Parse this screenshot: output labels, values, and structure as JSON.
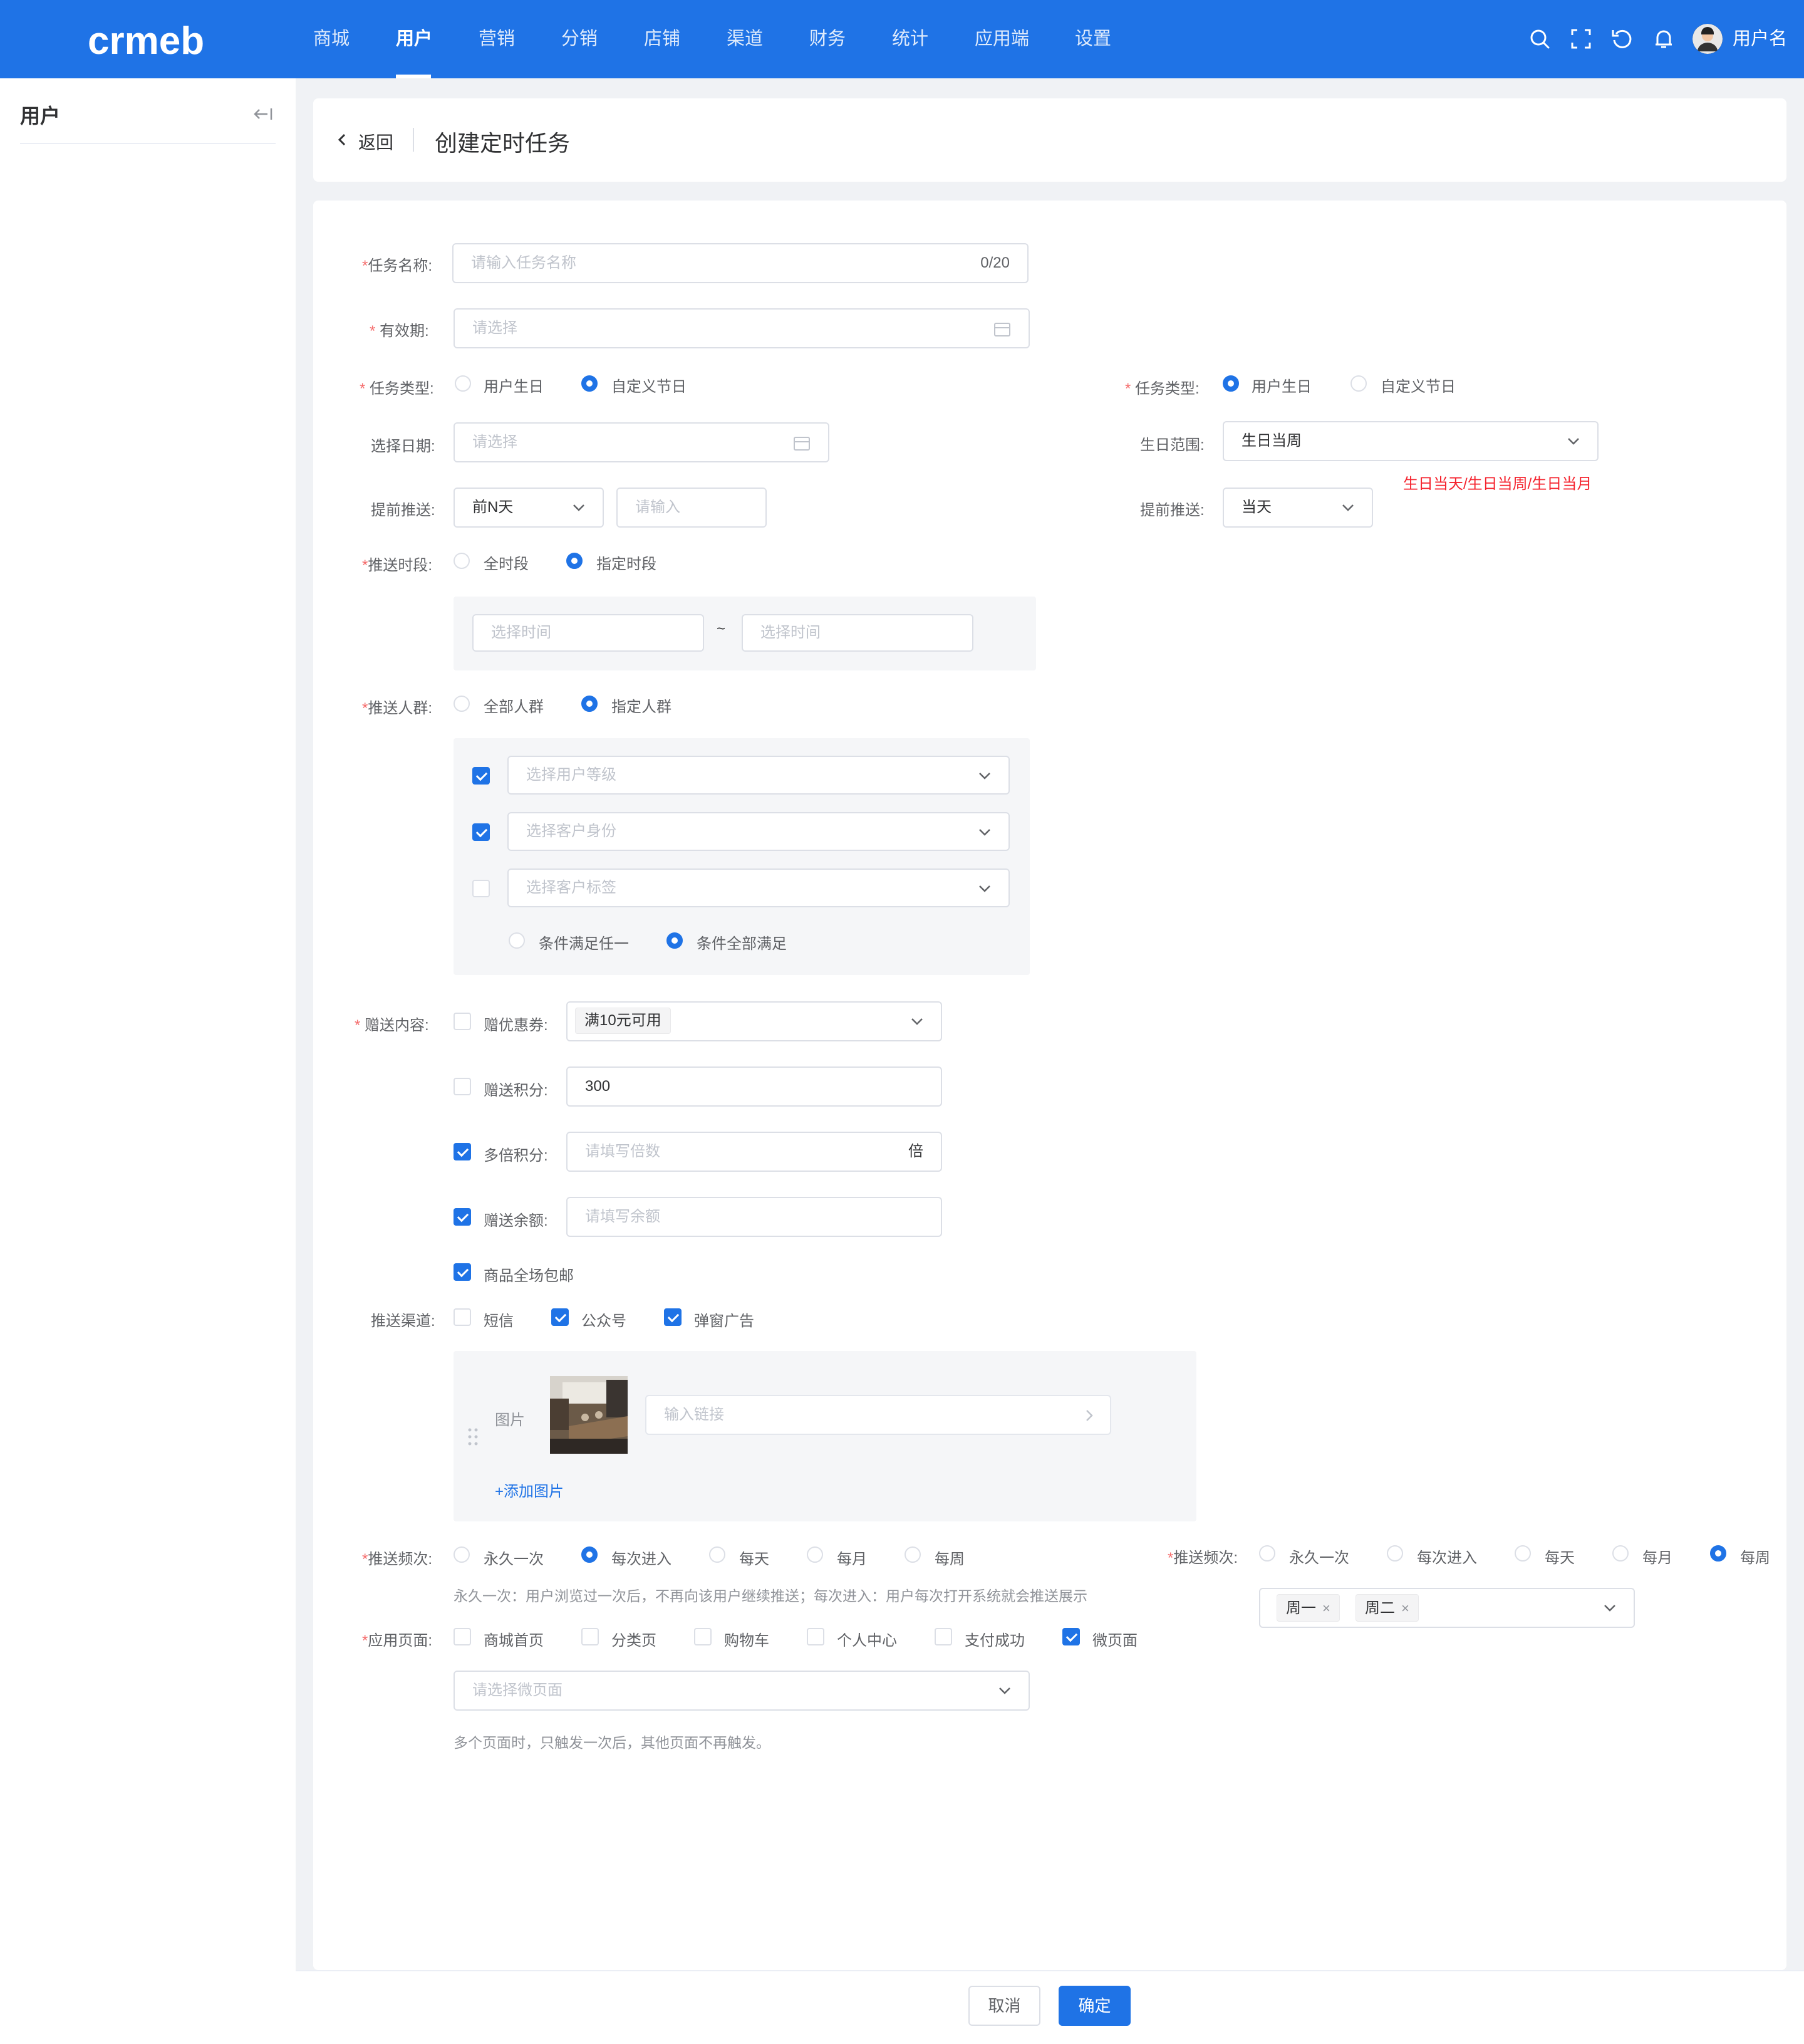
{
  "brand": {
    "logo_text": "crmeb",
    "accent": "#1f73e6"
  },
  "nav": {
    "items": [
      "商城",
      "用户",
      "营销",
      "分销",
      "店铺",
      "渠道",
      "财务",
      "统计",
      "应用端",
      "设置"
    ],
    "active": "用户"
  },
  "header_icons": [
    "search-icon",
    "fullscreen-icon",
    "refresh-icon",
    "bell-icon"
  ],
  "user": {
    "name": "用户名"
  },
  "sidebar": {
    "title": "用户"
  },
  "page": {
    "back": "返回",
    "title": "创建定时任务"
  },
  "form": {
    "task_name": {
      "label": "任务名称:",
      "placeholder": "请输入任务名称",
      "count": "0/20"
    },
    "validity": {
      "label": "有效期:",
      "placeholder": "请选择"
    },
    "task_type": {
      "label": "任务类型:",
      "options": [
        "用户生日",
        "自定义节日"
      ],
      "selected": "自定义节日"
    },
    "select_date": {
      "label": "选择日期:",
      "placeholder": "请选择"
    },
    "advance_push": {
      "label": "提前推送:",
      "select_value": "前N天",
      "input_placeholder": "请输入"
    },
    "push_period": {
      "label": "推送时段:",
      "options": [
        "全时段",
        "指定时段"
      ],
      "selected": "指定时段",
      "start_placeholder": "选择时间",
      "end_placeholder": "选择时间",
      "separator": "~"
    },
    "push_crowd": {
      "label": "推送人群:",
      "options": [
        "全部人群",
        "指定人群"
      ],
      "selected": "指定人群",
      "filters": [
        {
          "placeholder": "选择用户等级",
          "checked": true
        },
        {
          "placeholder": "选择客户身份",
          "checked": true
        },
        {
          "placeholder": "选择客户标签",
          "checked": false
        }
      ],
      "match_options": [
        "条件满足任一",
        "条件全部满足"
      ],
      "match_selected": "条件全部满足"
    },
    "gift": {
      "label": "赠送内容:",
      "coupon": {
        "label": "赠优惠券:",
        "checked": false,
        "tag": "满10元可用"
      },
      "points": {
        "label": "赠送积分:",
        "checked": false,
        "value": "300"
      },
      "multi_points": {
        "label": "多倍积分:",
        "checked": true,
        "placeholder": "请填写倍数",
        "suffix": "倍"
      },
      "balance": {
        "label": "赠送余额:",
        "checked": true,
        "placeholder": "请填写余额"
      },
      "free_shipping": {
        "label": "商品全场包邮",
        "checked": true
      }
    },
    "channel": {
      "label": "推送渠道:",
      "options": [
        {
          "label": "短信",
          "checked": false
        },
        {
          "label": "公众号",
          "checked": true
        },
        {
          "label": "弹窗广告",
          "checked": true
        }
      ],
      "image_label": "图片",
      "link_placeholder": "输入链接",
      "add_image": "+添加图片"
    },
    "frequency": {
      "label": "推送频次:",
      "options": [
        "永久一次",
        "每次进入",
        "每天",
        "每月",
        "每周"
      ],
      "selected": "每次进入",
      "hint": "永久一次：用户浏览过一次后，不再向该用户继续推送；每次进入：用户每次打开系统就会推送展示"
    },
    "apply_page": {
      "label": "应用页面:",
      "options": [
        {
          "label": "商城首页",
          "checked": false
        },
        {
          "label": "分类页",
          "checked": false
        },
        {
          "label": "购物车",
          "checked": false
        },
        {
          "label": "个人中心",
          "checked": false
        },
        {
          "label": "支付成功",
          "checked": false
        },
        {
          "label": "微页面",
          "checked": true
        }
      ],
      "select_placeholder": "请选择微页面",
      "hint": "多个页面时，只触发一次后，其他页面不再触发。"
    }
  },
  "right": {
    "task_type": {
      "label": "任务类型:",
      "options": [
        "用户生日",
        "自定义节日"
      ],
      "selected": "用户生日"
    },
    "birthday_range": {
      "label": "生日范围:",
      "value": "生日当周",
      "note": "生日当天/生日当周/生日当月"
    },
    "advance_push": {
      "label": "提前推送:",
      "value": "当天"
    },
    "frequency": {
      "label": "推送频次:",
      "options": [
        "永久一次",
        "每次进入",
        "每天",
        "每月",
        "每周"
      ],
      "selected": "每周",
      "tags": [
        "周一",
        "周二"
      ]
    }
  },
  "footer": {
    "cancel": "取消",
    "ok": "确定"
  }
}
